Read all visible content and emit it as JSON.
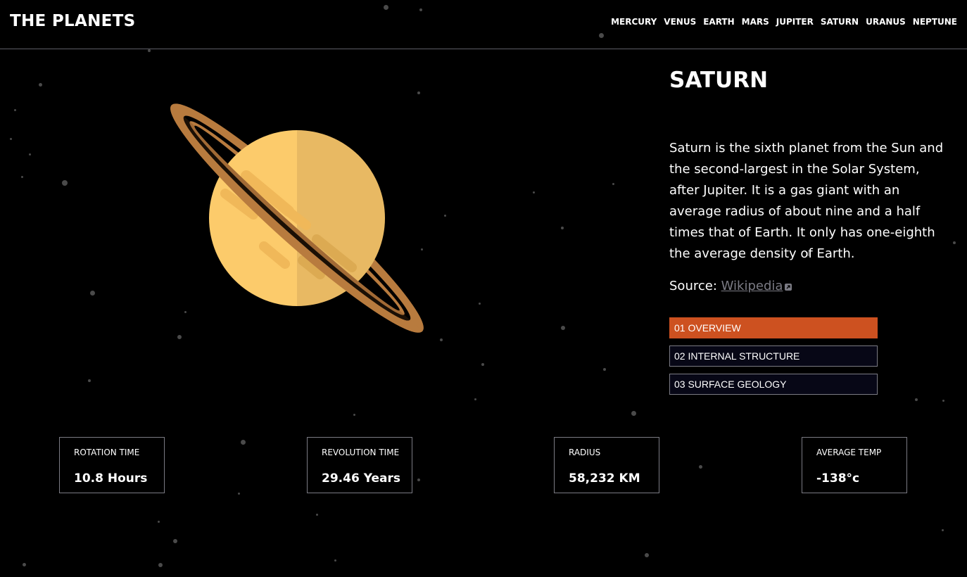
{
  "header": {
    "logo": "THE PLANETS",
    "nav": [
      "MERCURY",
      "VENUS",
      "EARTH",
      "MARS",
      "JUPITER",
      "SATURN",
      "URANUS",
      "NEPTUNE"
    ]
  },
  "planet": {
    "name": "SATURN",
    "description": "Saturn is the sixth planet from the Sun and the second-largest in the Solar System, after Jupiter. It is a gas giant with an average radius of about nine and a half times that of Earth. It only has one-eighth the average density of Earth.",
    "source_label": "Source:",
    "source_link": "Wikipedia",
    "colors": {
      "body_light": "#fccb6b",
      "body_shade": "#e8b963",
      "ring": "#b87b3e",
      "ring_dark": "#a26a35"
    }
  },
  "tabs": [
    {
      "label": "01 OVERVIEW",
      "active": true
    },
    {
      "label": "02 INTERNAL STRUCTURE",
      "active": false
    },
    {
      "label": "03 SURFACE GEOLOGY",
      "active": false
    }
  ],
  "stats": [
    {
      "label": "ROTATION TIME",
      "value": "10.8 Hours"
    },
    {
      "label": "REVOLUTION TIME",
      "value": "29.46 Years"
    },
    {
      "label": "RADIUS",
      "value": "58,232 KM"
    },
    {
      "label": "AVERAGE TEMP",
      "value": "-138°c"
    }
  ],
  "colors": {
    "accent": "#cd5120",
    "background": "#000000",
    "border": "#7b7b84",
    "tab_bg": "#070716"
  }
}
